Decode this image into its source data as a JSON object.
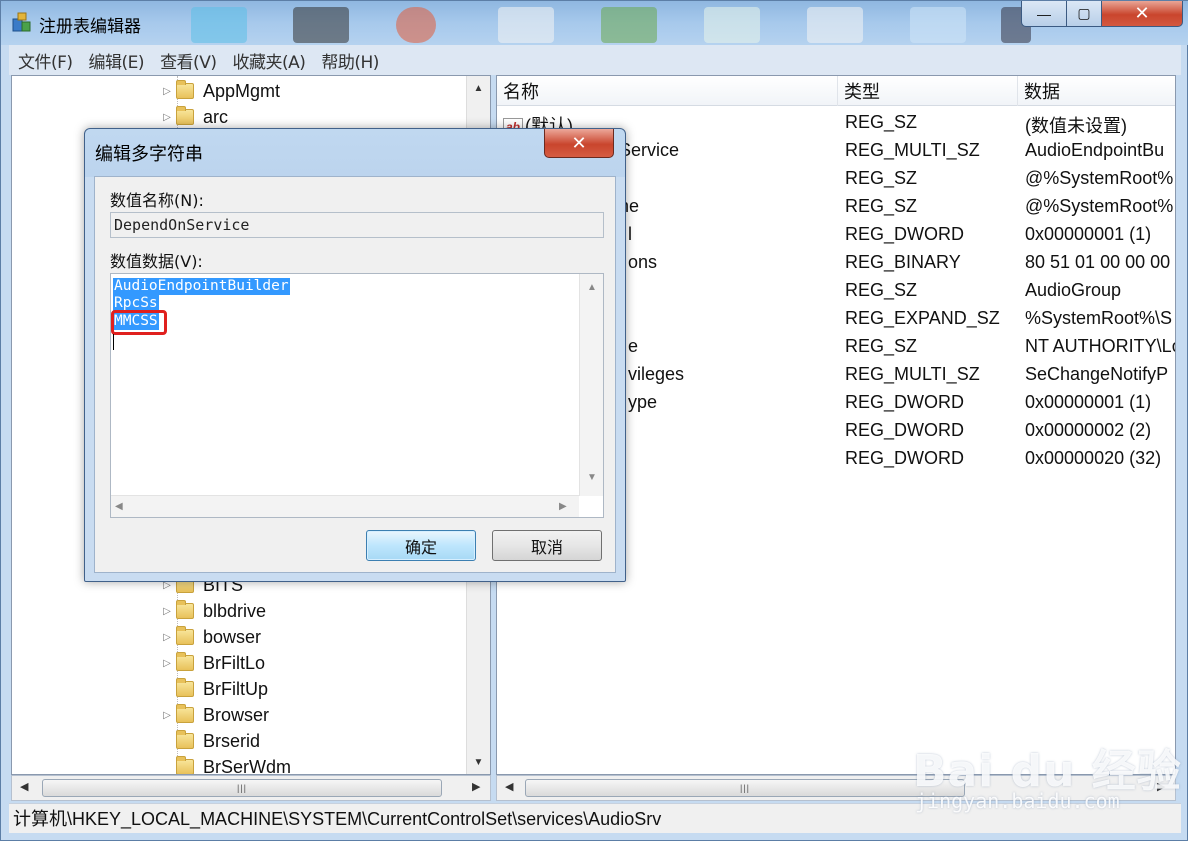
{
  "window": {
    "title": "注册表编辑器",
    "menus": [
      "文件(F)",
      "编辑(E)",
      "查看(V)",
      "收藏夹(A)",
      "帮助(H)"
    ]
  },
  "tree": {
    "items_top": [
      {
        "label": "AppMgmt",
        "expander": true
      },
      {
        "label": "arc",
        "expander": true
      }
    ],
    "items_bottom": [
      {
        "label": "BITS",
        "expander": true
      },
      {
        "label": "blbdrive",
        "expander": true
      },
      {
        "label": "bowser",
        "expander": true
      },
      {
        "label": "BrFiltLo",
        "expander": true
      },
      {
        "label": "BrFiltUp",
        "expander": false
      },
      {
        "label": "Browser",
        "expander": true
      },
      {
        "label": "Brserid",
        "expander": false
      },
      {
        "label": "BrSerWdm",
        "expander": false
      }
    ]
  },
  "list": {
    "columns": [
      "名称",
      "类型",
      "数据"
    ],
    "rows": [
      {
        "name": "(默认)",
        "type": "REG_SZ",
        "data": "(数值未设置)"
      },
      {
        "name": "Service",
        "type": "REG_MULTI_SZ",
        "data": "AudioEndpointBu"
      },
      {
        "name": "",
        "type": "REG_SZ",
        "data": "@%SystemRoot%"
      },
      {
        "name": "ne",
        "type": "REG_SZ",
        "data": "@%SystemRoot%"
      },
      {
        "name": "l",
        "type": "REG_DWORD",
        "data": "0x00000001 (1)"
      },
      {
        "name": "ons",
        "type": "REG_BINARY",
        "data": "80 51 01 00 00 00"
      },
      {
        "name": "",
        "type": "REG_SZ",
        "data": "AudioGroup"
      },
      {
        "name": "",
        "type": "REG_EXPAND_SZ",
        "data": "%SystemRoot%\\S"
      },
      {
        "name": "e",
        "type": "REG_SZ",
        "data": "NT AUTHORITY\\Lo"
      },
      {
        "name": "vileges",
        "type": "REG_MULTI_SZ",
        "data": "SeChangeNotifyP"
      },
      {
        "name": "ype",
        "type": "REG_DWORD",
        "data": "0x00000001 (1)"
      },
      {
        "name": "",
        "type": "REG_DWORD",
        "data": "0x00000002 (2)"
      },
      {
        "name": "",
        "type": "REG_DWORD",
        "data": "0x00000020 (32)"
      }
    ]
  },
  "status": "计算机\\HKEY_LOCAL_MACHINE\\SYSTEM\\CurrentControlSet\\services\\AudioSrv",
  "dialog": {
    "title": "编辑多字符串",
    "name_label": "数值名称(N):",
    "name_value": "DependOnService",
    "data_label": "数值数据(V):",
    "data_lines": [
      "AudioEndpointBuilder",
      "RpcSs",
      "MMCSS"
    ],
    "ok": "确定",
    "cancel": "取消"
  },
  "watermark": {
    "logo": "Bai du 经验",
    "url": "jingyan.baidu.com"
  },
  "colors": {
    "selection": "#3399ff",
    "highlight_box": "#e0201e",
    "close_button": "#c9452d"
  }
}
